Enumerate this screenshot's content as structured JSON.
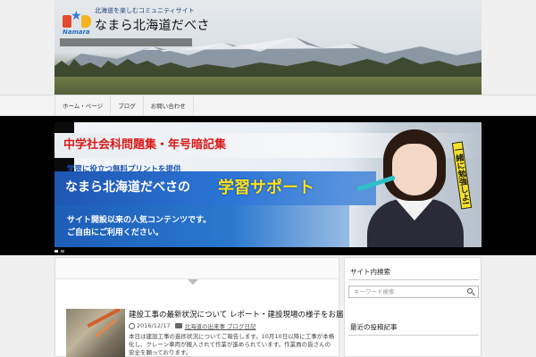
{
  "header": {
    "tagline": "北海道を楽しむコミュニティサイト",
    "site_title": "なまら北海道だべさ",
    "logo_text": "Namara"
  },
  "nav": {
    "items": [
      {
        "label": "ホーム・ページ"
      },
      {
        "label": "ブログ"
      },
      {
        "label": "お問い合わせ"
      }
    ]
  },
  "banner": {
    "title": "中学社会科問題集・年号暗記集",
    "subtitle": "学習に役立つ無料プリントを提供",
    "main_a": "なまら北海道だべさの",
    "main_b": "学習サポート",
    "note1": "サイト開設以来の人気コンテンツです。",
    "note2": "ご自由にご利用ください。",
    "bubble": "一緒に勉強しよ!"
  },
  "post": {
    "title": "建設工事の最新状況について レポート・建設現場の様子をお届けします",
    "date": "2016/12/17",
    "category": "北海道の出来事 ブログ日記",
    "excerpt": "本日は建設工事の進捗状況についてご報告します。10月10日以降に工事が本格化し、クレーン車両が搬入されて作業が進められています。作業員の皆さんの安全を願っております。"
  },
  "sidebar": {
    "search_heading": "サイト内検索",
    "search_placeholder": "キーワード検索",
    "recent_heading": "最近の投稿記事"
  },
  "colors": {
    "band": "#000000",
    "banner_title": "#d91a1a",
    "banner_blue": "#2b76d6",
    "banner_yellow": "#ffe21a"
  }
}
